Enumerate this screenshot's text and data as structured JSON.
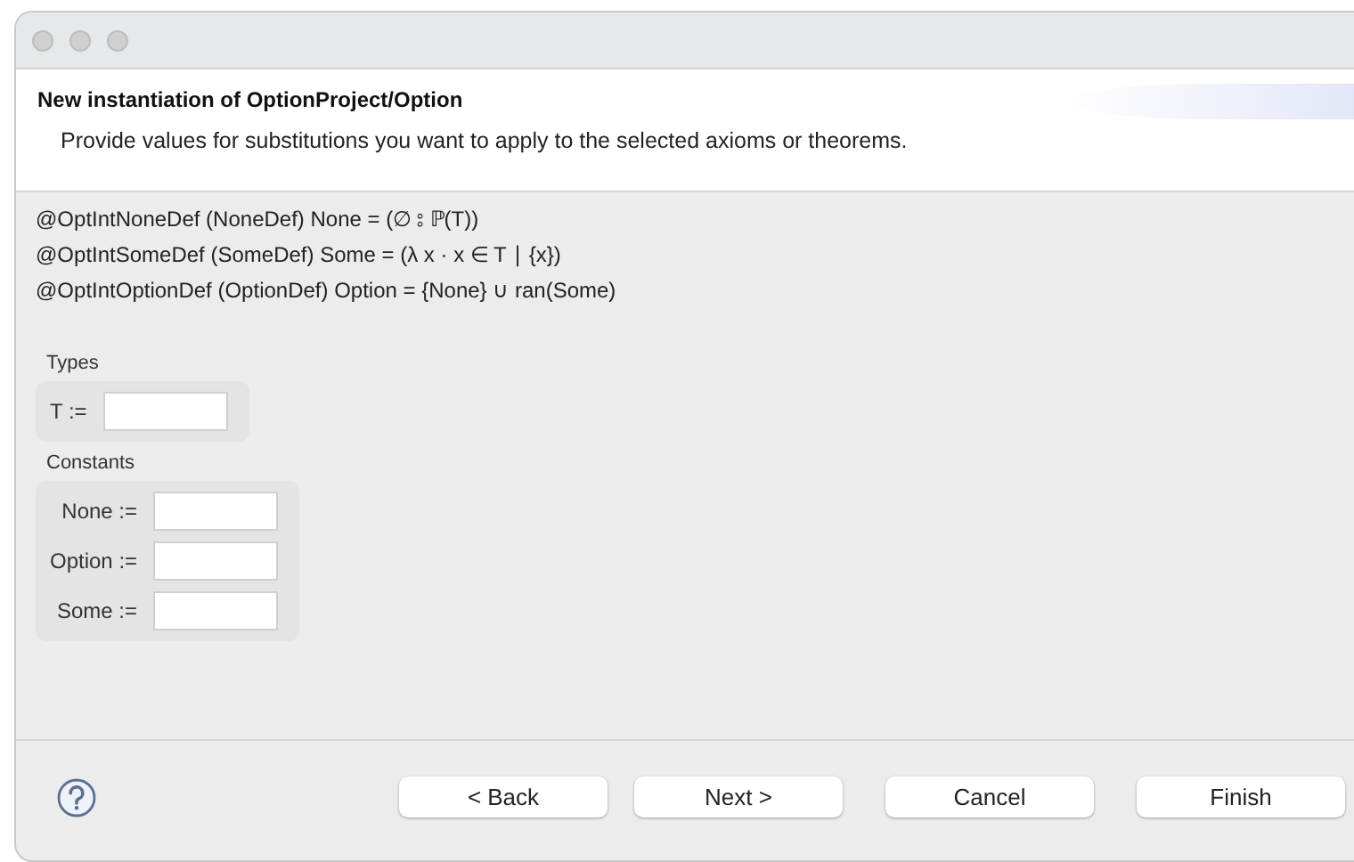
{
  "header": {
    "title": "New instantiation of OptionProject/Option",
    "description": "Provide values for substitutions you want to apply to the selected axioms or theorems."
  },
  "definitions": [
    "@OptIntNoneDef (NoneDef) None = (∅ ⦂ ℙ(T))",
    "@OptIntSomeDef (SomeDef) Some = (λ x · x ∈ T ∣ {x})",
    "@OptIntOptionDef (OptionDef) Option = {None} ∪ ran(Some)"
  ],
  "groups": [
    {
      "label": "Types",
      "fields": [
        {
          "label": "T :="
        }
      ]
    },
    {
      "label": "Constants",
      "fields": [
        {
          "label": "None :="
        },
        {
          "label": "Option :="
        },
        {
          "label": "Some :="
        }
      ]
    }
  ],
  "buttons": [
    "< Back",
    "Next >",
    "Cancel",
    "Finish"
  ]
}
